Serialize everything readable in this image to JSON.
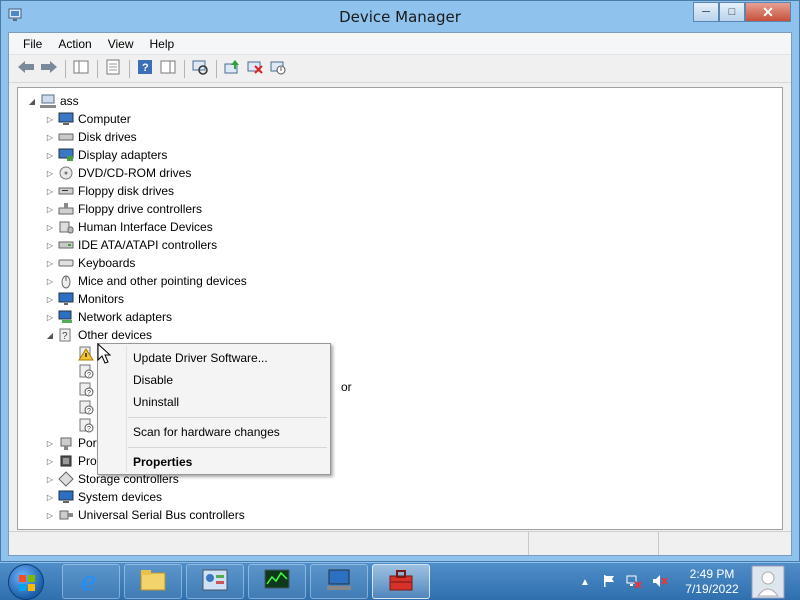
{
  "window": {
    "title": "Device Manager"
  },
  "menubar": {
    "items": [
      "File",
      "Action",
      "View",
      "Help"
    ]
  },
  "toolbar": {
    "buttons": [
      "back-icon",
      "forward-icon",
      "show-hide-console-tree-icon",
      "properties-icon",
      "help-icon",
      "show-hide-action-pane-icon",
      "scan-hardware-icon",
      "update-driver-icon",
      "uninstall-icon",
      "disable-icon"
    ]
  },
  "tree": {
    "root": "ass",
    "categories": [
      "Computer",
      "Disk drives",
      "Display adapters",
      "DVD/CD-ROM drives",
      "Floppy disk drives",
      "Floppy drive controllers",
      "Human Interface Devices",
      "IDE ATA/ATAPI controllers",
      "Keyboards",
      "Mice and other pointing devices",
      "Monitors",
      "Network adapters",
      "Other devices"
    ],
    "other_devices_children": [
      "",
      "",
      "",
      "",
      ""
    ],
    "partial_label_row3": "or",
    "bottom_categories": [
      "Port",
      "Proc",
      "Storage controllers",
      "System devices",
      "Universal Serial Bus controllers"
    ]
  },
  "context_menu": {
    "items": [
      "Update Driver Software...",
      "Disable",
      "Uninstall",
      "Scan for hardware changes",
      "Properties"
    ]
  },
  "taskbar": {
    "apps": [
      "Windows Explorer",
      "Internet Explorer",
      "File Explorer",
      "Control Panel",
      "Performance Monitor",
      "Device Manager Tool",
      "Toolbox"
    ],
    "clock_time": "2:49 PM",
    "clock_date": "7/19/2022"
  }
}
